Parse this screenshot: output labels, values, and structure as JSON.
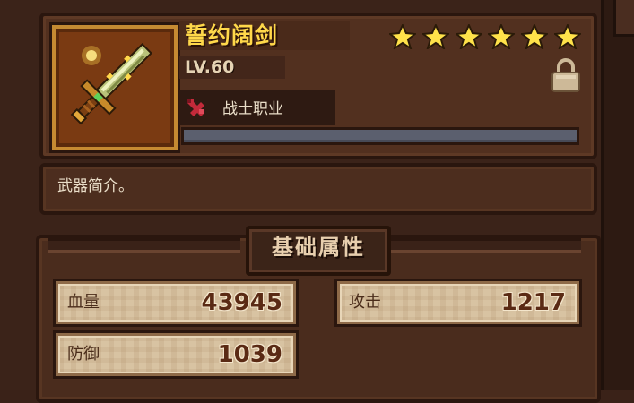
{
  "item": {
    "name": "誓约阔剑",
    "level": "LV.60",
    "stars": 6,
    "class_label": "战士职业",
    "description": "武器简介。",
    "locked": true,
    "icon": "sword-icon",
    "class_icon": "warrior-class-icon"
  },
  "attributes": {
    "title": "基础属性",
    "stats": [
      {
        "label": "血量",
        "value": "43945"
      },
      {
        "label": "攻击",
        "value": "1217"
      },
      {
        "label": "防御",
        "value": "1039"
      }
    ]
  },
  "colors": {
    "name": "#ffd84a",
    "star": "#ffe24a",
    "frame": "#c58a32",
    "stat_value": "#5a2a14"
  }
}
